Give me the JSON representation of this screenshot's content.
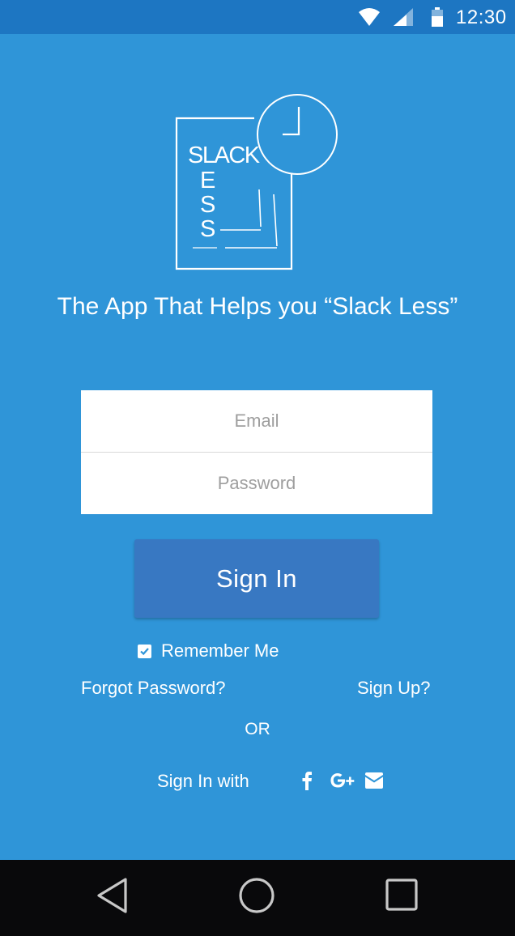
{
  "status_bar": {
    "time": "12:30",
    "icons": [
      "wifi-icon",
      "cellular-signal-icon",
      "battery-icon"
    ]
  },
  "logo": {
    "text_lines": [
      "SLACK",
      "E",
      "S",
      "S"
    ]
  },
  "tagline": "The App That Helps you “Slack Less”",
  "form": {
    "email_placeholder": "Email",
    "email_value": "",
    "password_placeholder": "Password",
    "password_value": ""
  },
  "signin_button_label": "Sign In",
  "remember_me": {
    "label": "Remember Me",
    "checked": true
  },
  "forgot_password_label": "Forgot Password?",
  "sign_up_label": "Sign Up?",
  "or_label": "OR",
  "sign_in_with_label": "Sign In with",
  "social_icons": [
    "facebook-icon",
    "google-plus-icon",
    "email-icon"
  ],
  "nav_icons": [
    "back-triangle-icon",
    "home-circle-icon",
    "recents-square-icon"
  ],
  "colors": {
    "background": "#2f95d8",
    "status_bar": "#1d76c2",
    "button": "#3878c2",
    "nav_bar": "#09090b"
  }
}
